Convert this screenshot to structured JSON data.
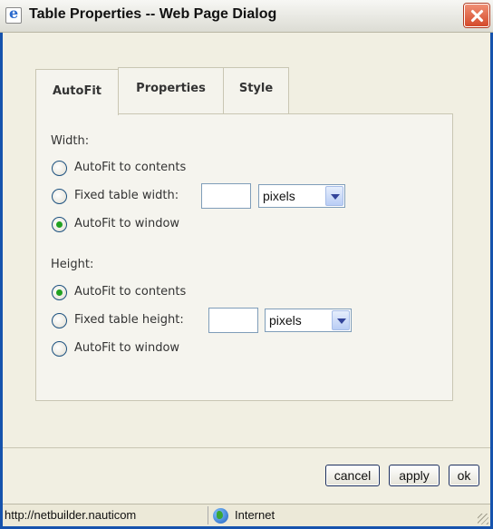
{
  "window": {
    "title": "Table Properties -- Web Page Dialog"
  },
  "tabs": [
    {
      "label": "AutoFit",
      "active": true
    },
    {
      "label": "Properties",
      "active": false
    },
    {
      "label": "Style",
      "active": false
    }
  ],
  "width_section": {
    "label": "Width:",
    "options": [
      {
        "label": "AutoFit to contents",
        "checked": false
      },
      {
        "label": "Fixed table width:",
        "checked": false
      },
      {
        "label": "AutoFit to window",
        "checked": true
      }
    ],
    "fixed_value": "",
    "unit": "pixels"
  },
  "height_section": {
    "label": "Height:",
    "options": [
      {
        "label": "AutoFit to contents",
        "checked": true
      },
      {
        "label": "Fixed table height:",
        "checked": false
      },
      {
        "label": "AutoFit to window",
        "checked": false
      }
    ],
    "fixed_value": "",
    "unit": "pixels"
  },
  "buttons": {
    "cancel": "cancel",
    "apply": "apply",
    "ok": "ok"
  },
  "statusbar": {
    "url": "http://netbuilder.nauticom",
    "zone": "Internet"
  },
  "colors": {
    "frame": "#1653ad",
    "checked_radio": "#21a121",
    "close_button": "#d44a2b"
  }
}
